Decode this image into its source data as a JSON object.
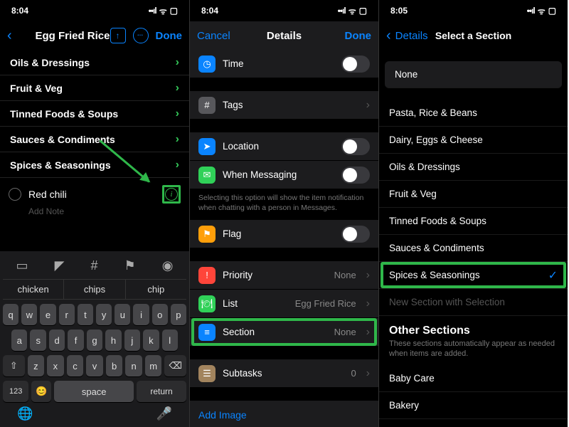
{
  "panel1": {
    "time": "8:04",
    "back_label": "",
    "title": "Egg Fried Rice",
    "done": "Done",
    "sections": [
      "Oils & Dressings",
      "Fruit & Veg",
      "Tinned Foods & Soups",
      "Sauces & Condiments",
      "Spices & Seasonings"
    ],
    "item": "Red chili",
    "add_note": "Add Note",
    "suggestions": [
      "chicken",
      "chips",
      "chip"
    ],
    "keys_r1": [
      "q",
      "w",
      "e",
      "r",
      "t",
      "y",
      "u",
      "i",
      "o",
      "p"
    ],
    "keys_r2": [
      "a",
      "s",
      "d",
      "f",
      "g",
      "h",
      "j",
      "k",
      "l"
    ],
    "keys_r3": [
      "z",
      "x",
      "c",
      "v",
      "b",
      "n",
      "m"
    ],
    "key_shift": "⇧",
    "key_del": "⌫",
    "key_123": "123",
    "key_emoji": "😊",
    "key_space": "space",
    "key_return": "return",
    "key_globe": "🌐",
    "key_mic": "🎤"
  },
  "panel2": {
    "time": "8:04",
    "cancel": "Cancel",
    "title": "Details",
    "done": "Done",
    "rows": {
      "time": "Time",
      "tags": "Tags",
      "location": "Location",
      "messaging": "When Messaging",
      "messaging_hint": "Selecting this option will show the item notification when chatting with a person in Messages.",
      "flag": "Flag",
      "priority": "Priority",
      "priority_val": "None",
      "list": "List",
      "list_val": "Egg Fried Rice",
      "section": "Section",
      "section_val": "None",
      "subtasks": "Subtasks",
      "subtasks_val": "0",
      "add_image": "Add Image"
    }
  },
  "panel3": {
    "time": "8:05",
    "back": "Details",
    "title": "Select a Section",
    "none": "None",
    "sections": [
      "Pasta, Rice & Beans",
      "Dairy, Eggs & Cheese",
      "Oils & Dressings",
      "Fruit & Veg",
      "Tinned Foods & Soups",
      "Sauces & Condiments",
      "Spices & Seasonings"
    ],
    "new_section": "New Section with Selection",
    "other_header": "Other Sections",
    "other_sub": "These sections automatically appear as needed when items are added.",
    "other": [
      "Baby Care",
      "Bakery"
    ]
  },
  "battery": "51"
}
